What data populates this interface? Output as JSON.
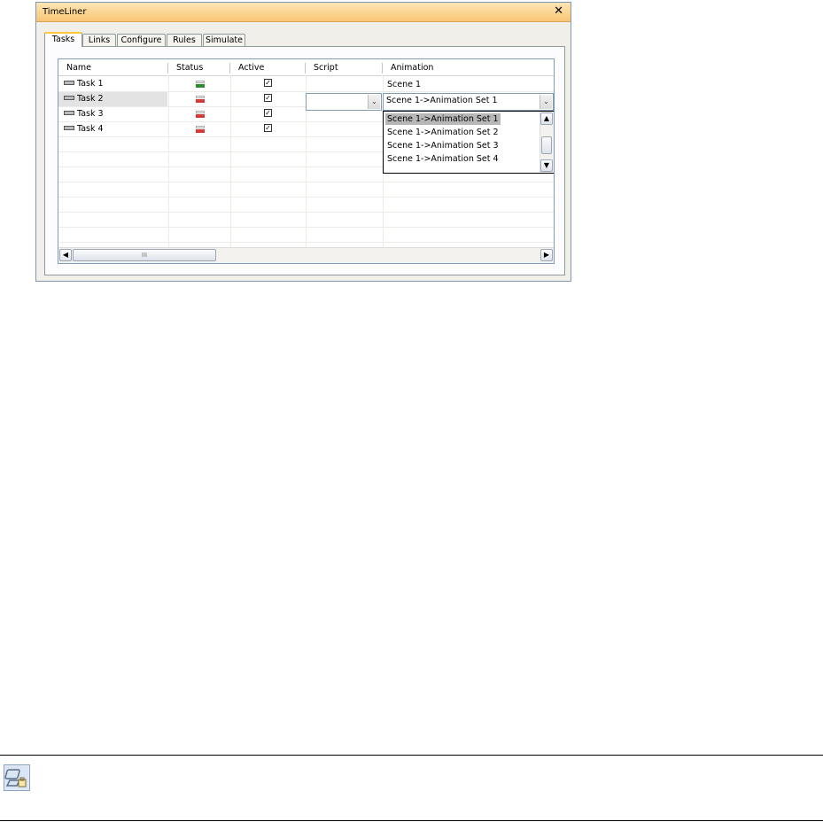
{
  "window": {
    "title": "TimeLiner"
  },
  "tabs": [
    {
      "label": "Tasks",
      "active": true
    },
    {
      "label": "Links"
    },
    {
      "label": "Configure"
    },
    {
      "label": "Rules"
    },
    {
      "label": "Simulate"
    }
  ],
  "grid": {
    "columns": [
      "Name",
      "Status",
      "Active",
      "Script",
      "Animation"
    ],
    "rows": [
      {
        "name": "Task 1",
        "status_color": "#2e8b2e",
        "active": true,
        "animation": "Scene 1"
      },
      {
        "name": "Task 2",
        "status_color": "#d43a3a",
        "active": true,
        "animation": ""
      },
      {
        "name": "Task 3",
        "status_color": "#d43a3a",
        "active": true,
        "animation": ""
      },
      {
        "name": "Task 4",
        "status_color": "#d43a3a",
        "active": true,
        "animation": ""
      }
    ],
    "check_glyph": "✓"
  },
  "animation_combo": {
    "value": "Scene 1->Animation Set 1",
    "options": [
      "Scene 1->Animation Set 1",
      "Scene 1->Animation Set 2",
      "Scene 1->Animation Set 3",
      "Scene 1->Animation Set 4"
    ],
    "selected_index": 0
  },
  "scrollbar": {
    "thumb_grip": "III"
  },
  "icons": {
    "close": "✕",
    "dropdown": "⌄",
    "scroll_up": "▲",
    "scroll_down": "▼",
    "scroll_left": "◀",
    "scroll_right": "▶"
  }
}
